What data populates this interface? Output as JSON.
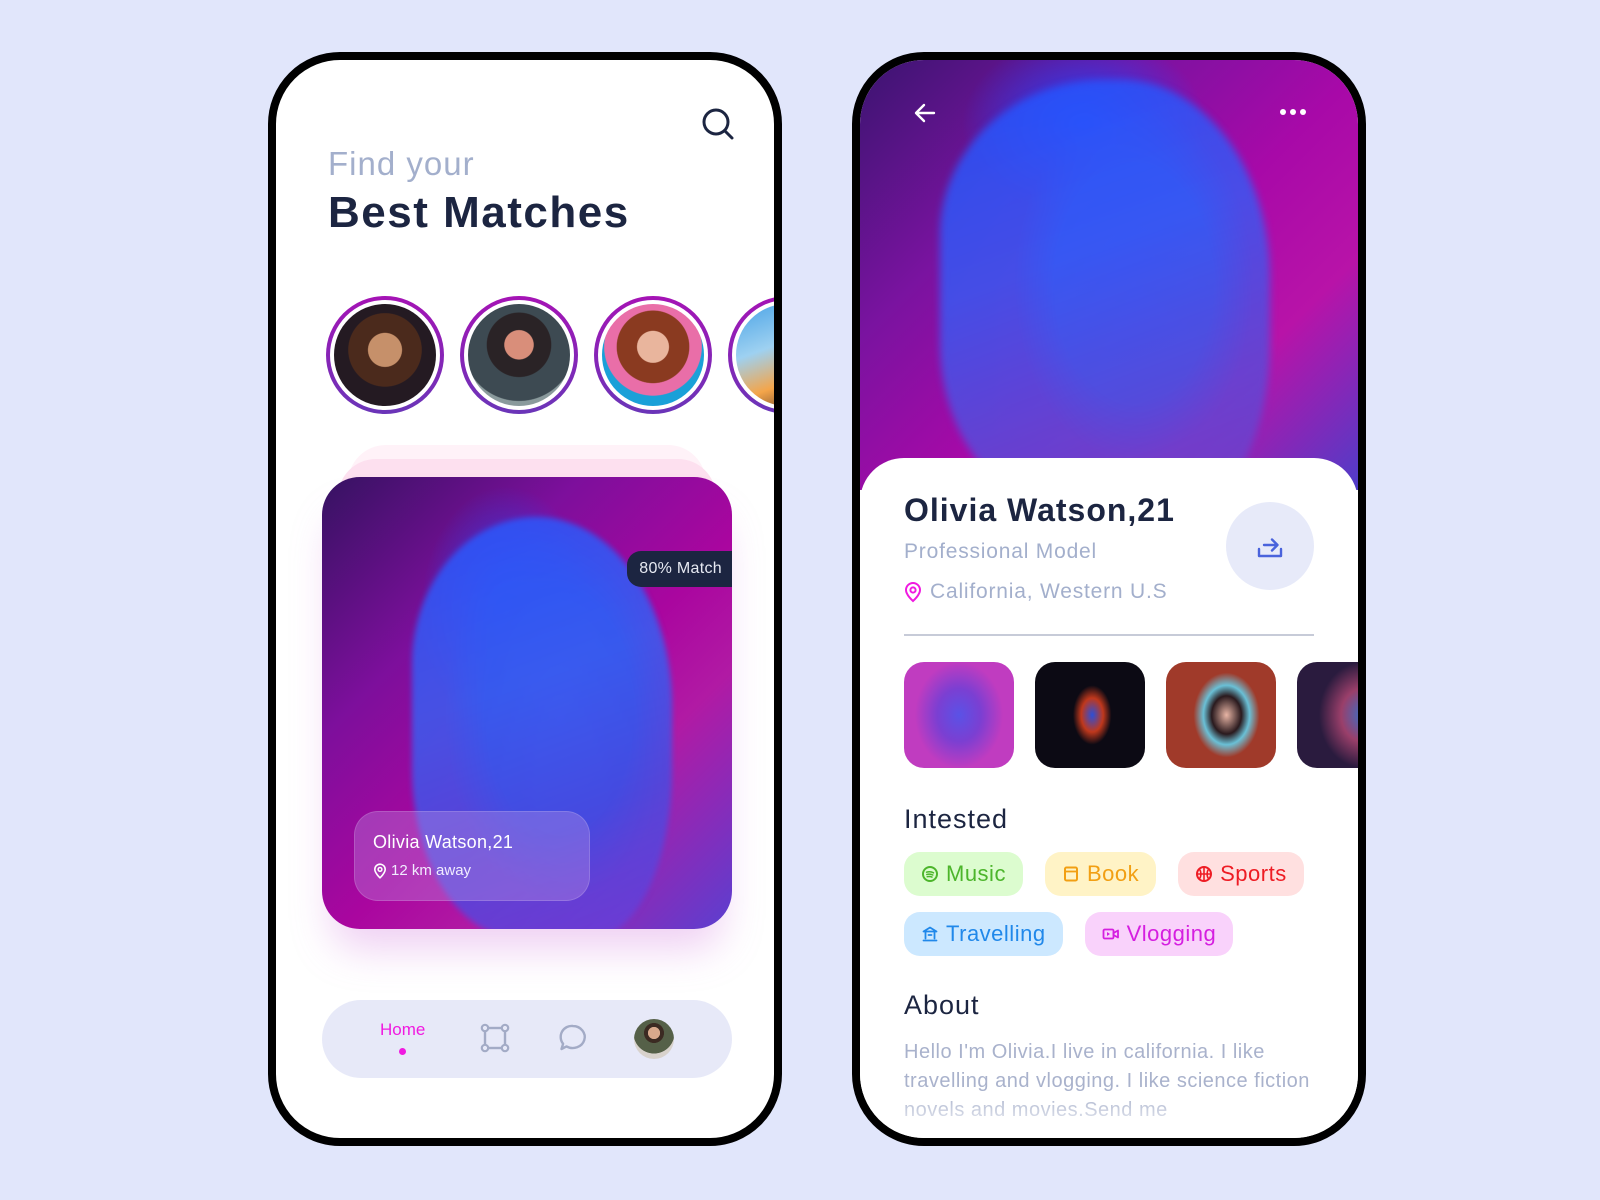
{
  "colors": {
    "background": "#e1e6fb",
    "accent_pink": "#f01ae0",
    "dark_text": "#1c2541",
    "muted_text": "#a3afcc",
    "story_ring_start": "#a513b5",
    "story_ring_end": "#6a35b8",
    "share_icon": "#4a63dc"
  },
  "home_screen": {
    "title_line1": "Find your",
    "title_line2": "Best Matches",
    "search_icon": "search-icon",
    "stories": [
      {
        "name": "story-1"
      },
      {
        "name": "story-2"
      },
      {
        "name": "story-3"
      },
      {
        "name": "story-4"
      }
    ],
    "featured_card": {
      "match_badge": "80% Match",
      "name": "Olivia Watson,21",
      "distance": "12 km away",
      "distance_icon": "location-pin-icon"
    },
    "bottom_nav": {
      "home_label": "Home",
      "items": [
        {
          "icon": "frame-icon"
        },
        {
          "icon": "chat-bubble-icon"
        },
        {
          "icon": "profile-avatar"
        }
      ],
      "active": "Home"
    }
  },
  "profile_screen": {
    "back_icon": "arrow-left-icon",
    "more_icon": "more-horizontal-icon",
    "name": "Olivia Watson,21",
    "role": "Professional Model",
    "location": "California, Western U.S",
    "share_icon": "share-icon",
    "gallery": [
      {
        "name": "gallery-photo-1"
      },
      {
        "name": "gallery-photo-2"
      },
      {
        "name": "gallery-photo-3"
      },
      {
        "name": "gallery-photo-4"
      }
    ],
    "interests_title": "Intested",
    "interests": [
      {
        "label": "Music",
        "icon": "music-icon",
        "bg": "#dcfccf",
        "fg": "#4cb52b"
      },
      {
        "label": "Book",
        "icon": "book-icon",
        "bg": "#fff3c6",
        "fg": "#f29f13"
      },
      {
        "label": "Sports",
        "icon": "basketball-icon",
        "bg": "#ffe0e0",
        "fg": "#ee1c24"
      },
      {
        "label": "Travelling",
        "icon": "landmark-icon",
        "bg": "#cce8ff",
        "fg": "#2088ea"
      },
      {
        "label": "Vlogging",
        "icon": "video-camera-icon",
        "bg": "#f9d2fb",
        "fg": "#d51fe0"
      }
    ],
    "about_title": "About",
    "about_text": "Hello I'm Olivia.I live in california. I like travelling and vlogging. I like science fiction novels and movies.Send me"
  }
}
